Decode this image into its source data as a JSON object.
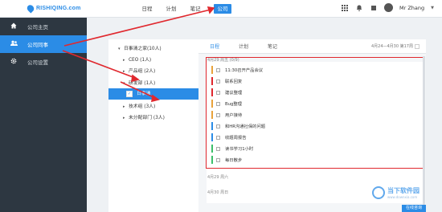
{
  "header": {
    "logo_text": "RISHIQING.com",
    "nav": [
      "日程",
      "计划",
      "笔记",
      "公司"
    ],
    "user_name": "Mr Zhang"
  },
  "sidebar": {
    "items": [
      {
        "label": "公司主页",
        "icon": "home-icon"
      },
      {
        "label": "公司同事",
        "icon": "users-icon"
      },
      {
        "label": "公司设置",
        "icon": "gear-icon"
      }
    ],
    "active_index": 1
  },
  "tree": {
    "root": "日事清之家(10人)",
    "nodes": [
      "CEO (1人)",
      "产品组 (2人)",
      "研发部 (1人)",
      "日事清",
      "技术组 (3人)",
      "未分配部门 (3人)"
    ]
  },
  "tabs": [
    "日程",
    "计划",
    "笔记"
  ],
  "date_range": "4月24—4月30  第17周",
  "days": [
    {
      "label": "4月29  周五  (0/9)"
    },
    {
      "label": "4月29  周六"
    },
    {
      "label": "4月30  周日"
    }
  ],
  "tasks": [
    {
      "text": "11:30召开产品会议",
      "color": "#e9a23b"
    },
    {
      "text": "联系回复",
      "color": "#e0282e"
    },
    {
      "text": "建议整理",
      "color": "#e0282e"
    },
    {
      "text": "Bug整理",
      "color": "#e9a23b"
    },
    {
      "text": "用户接待",
      "color": "#e9a23b"
    },
    {
      "text": "和HR沟通社保的问题",
      "color": "#2b8ce6"
    },
    {
      "text": "收题周报告",
      "color": "#2b8ce6"
    },
    {
      "text": "读书学习1小时",
      "color": "#3cbf6a"
    },
    {
      "text": "每日散步",
      "color": "#3cbf6a"
    }
  ],
  "bottom_button": "在线咨询",
  "watermark": {
    "title": "当下软件园",
    "sub": "www.downxia.com"
  }
}
